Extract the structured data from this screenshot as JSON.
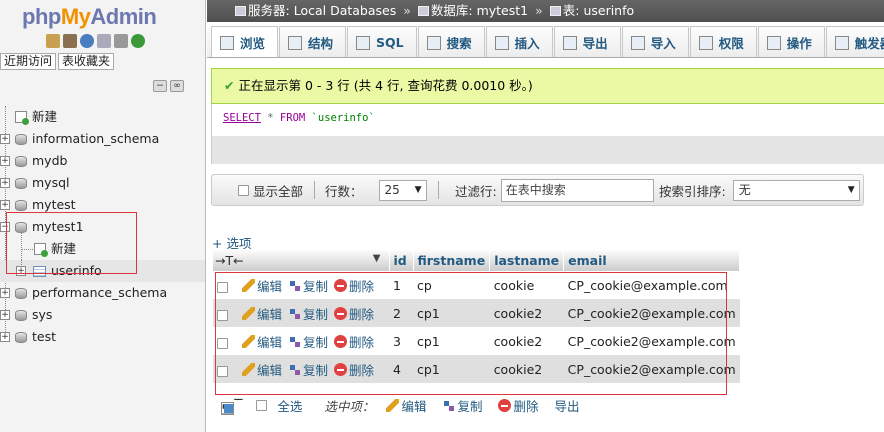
{
  "nav": {
    "logo_php": "php",
    "logo_my": "My",
    "logo_admin": "Admin",
    "tab_recent": "近期访问",
    "tab_favorites": "表收藏夹",
    "tree": [
      {
        "label": "新建",
        "type": "new"
      },
      {
        "label": "information_schema",
        "type": "db"
      },
      {
        "label": "mydb",
        "type": "db"
      },
      {
        "label": "mysql",
        "type": "db"
      },
      {
        "label": "mytest",
        "type": "db"
      },
      {
        "label": "mytest1",
        "type": "db-expanded"
      },
      {
        "label": "新建",
        "type": "child-new"
      },
      {
        "label": "userinfo",
        "type": "child-table"
      },
      {
        "label": "performance_schema",
        "type": "db"
      },
      {
        "label": "sys",
        "type": "db"
      },
      {
        "label": "test",
        "type": "db"
      }
    ],
    "highlight_color": "#d9363e"
  },
  "breadcrumb": {
    "server_label": "服务器:",
    "server": "Local Databases",
    "db_label": "数据库:",
    "db": "mytest1",
    "table_label": "表:",
    "table": "userinfo",
    "sep": "»"
  },
  "tabs": [
    "浏览",
    "结构",
    "SQL",
    "搜索",
    "插入",
    "导出",
    "导入",
    "权限",
    "操作",
    "触发器"
  ],
  "message": {
    "check": "✔",
    "text": "正在显示第 0 - 3 行 (共 4 行, 查询花费 0.0010 秒。)"
  },
  "sql": {
    "select": "SELECT",
    "star": "*",
    "from": "FROM",
    "table": "`userinfo`"
  },
  "navbar": {
    "show_all": "显示全部",
    "rows_label": "行数：",
    "rows_value": "25",
    "filter_label": "过滤行:",
    "filter_placeholder": "在表中搜索",
    "sort_label": "按索引排序:",
    "sort_value": "无"
  },
  "options_link": "+ 选项",
  "table": {
    "columns": [
      "id",
      "firstname",
      "lastname",
      "email"
    ],
    "actions": {
      "edit": "编辑",
      "copy": "复制",
      "delete": "删除"
    },
    "rows": [
      [
        "1",
        "cp",
        "cookie",
        "CP_cookie@example.com"
      ],
      [
        "2",
        "cp1",
        "cookie2",
        "CP_cookie2@example.com"
      ],
      [
        "3",
        "cp1",
        "cookie2",
        "CP_cookie2@example.com"
      ],
      [
        "4",
        "cp1",
        "cookie2",
        "CP_cookie2@example.com"
      ]
    ]
  },
  "bottom": {
    "select_all": "全选",
    "with_selected": "选中项：",
    "edit": "编辑",
    "copy": "复制",
    "delete": "删除",
    "export": "导出"
  }
}
